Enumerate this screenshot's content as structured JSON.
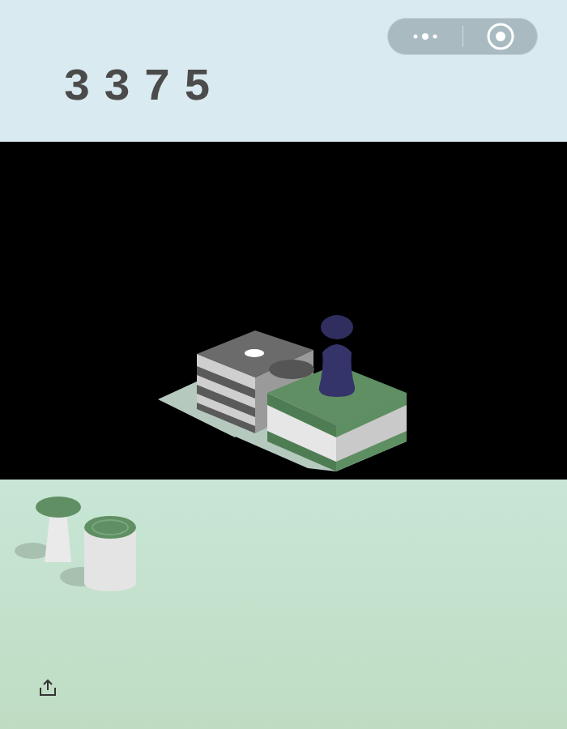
{
  "score": "3375"
}
